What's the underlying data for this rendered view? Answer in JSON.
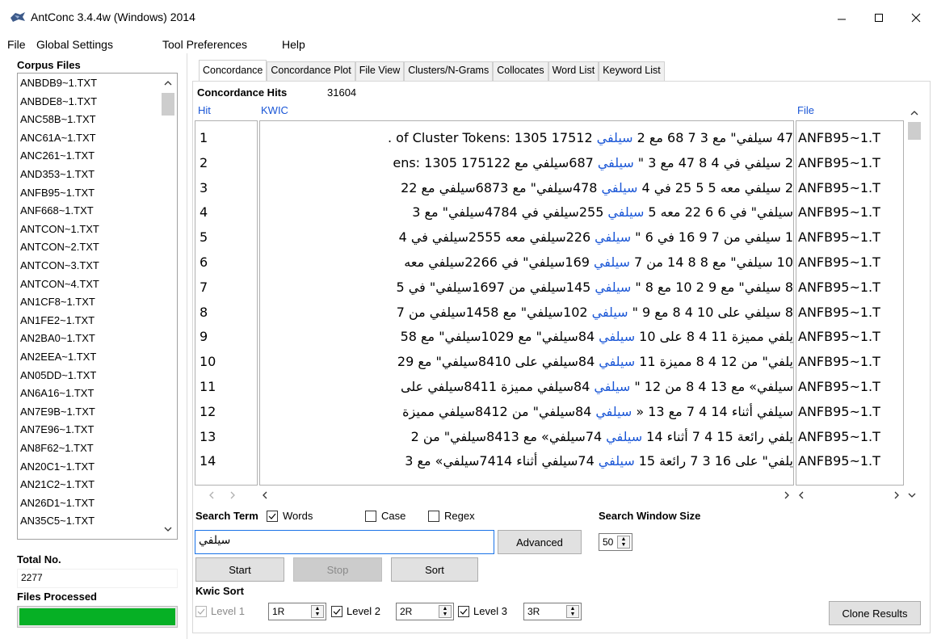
{
  "window": {
    "title": "AntConc 3.4.4w (Windows) 2014",
    "app_icon": "antconc-icon",
    "controls": {
      "minimize": "—",
      "maximize": "☐",
      "close": "✕"
    }
  },
  "menu": [
    "File",
    "Global Settings",
    "Tool Preferences",
    "Help"
  ],
  "corpus": {
    "title": "Corpus Files",
    "files": [
      "ANBDB9~1.TXT",
      "ANBDE8~1.TXT",
      "ANC58B~1.TXT",
      "ANC61A~1.TXT",
      "ANC261~1.TXT",
      "AND353~1.TXT",
      "ANFB95~1.TXT",
      "ANF668~1.TXT",
      "ANTCON~1.TXT",
      "ANTCON~2.TXT",
      "ANTCON~3.TXT",
      "ANTCON~4.TXT",
      "AN1CF8~1.TXT",
      "AN1FE2~1.TXT",
      "AN2BA0~1.TXT",
      "AN2EEA~1.TXT",
      "AN05DD~1.TXT",
      "AN6A16~1.TXT",
      "AN7E9B~1.TXT",
      "AN7E96~1.TXT",
      "AN8F62~1.TXT",
      "AN20C1~1.TXT",
      "AN21C2~1.TXT",
      "AN26D1~1.TXT",
      "AN35C5~1.TXT"
    ],
    "total_label": "Total No.",
    "total_value": "2277",
    "files_processed_label": "Files Processed",
    "progress": 1.0
  },
  "tabs": [
    "Concordance",
    "Concordance Plot",
    "File View",
    "Clusters/N-Grams",
    "Collocates",
    "Word List",
    "Keyword List"
  ],
  "active_tab": "Concordance",
  "concordance": {
    "hits_label": "Concordance Hits",
    "hits_value": "31604",
    "headers": {
      "hit": "Hit",
      "kwic": "KWIC",
      "file": "File"
    },
    "rows": [
      {
        "hit": "1",
        "left": "47 سيلفي\" مع 3 7 68 مع 2 ",
        "keyword": "سيلفي",
        "right": " 17512 1305 :of Cluster Tokens .",
        "file": "ANFB95~1.T"
      },
      {
        "hit": "2",
        "left": "2 سيلفي في 4 8 47 مع 3 \"",
        "keyword": "سيلفي",
        "right": "687سيلفي مع 175122 1305 :ens",
        "file": "ANFB95~1.T"
      },
      {
        "hit": "3",
        "left": "2 سيلفي معه 5 5 25 في 4 ",
        "keyword": "سيلفي",
        "right": "478سيلفي\" مع 6873سيلفي مع 22",
        "file": "ANFB95~1.T"
      },
      {
        "hit": "4",
        "left": "سيلفي\" في 6 6 22 معه 5 ",
        "keyword": "سيلفي",
        "right": "255سيلفي في 4784سيلفي\" مع 3",
        "file": "ANFB95~1.T"
      },
      {
        "hit": "5",
        "left": "1 سيلفي من 7 9 16 في 6 \"",
        "keyword": "سيلفي",
        "right": "226سيلفي معه 2555سيلفي في 4",
        "file": "ANFB95~1.T"
      },
      {
        "hit": "6",
        "left": "10 سيلفي\" مع 8 8 14 من 7 ",
        "keyword": "سيلفي",
        "right": "169سيلفي\" في 2266سيلفي معه",
        "file": "ANFB95~1.T"
      },
      {
        "hit": "7",
        "left": "8 سيلفي\" مع 9 2 10 مع 8 \"",
        "keyword": "سيلفي",
        "right": "145سيلفي من 1697سيلفي\" في 5",
        "file": "ANFB95~1.T"
      },
      {
        "hit": "8",
        "left": "8 سيلفي على 10 4 8 مع 9 \"",
        "keyword": "سيلفي",
        "right": "102سيلفي\" مع 1458سيلفي من 7",
        "file": "ANFB95~1.T"
      },
      {
        "hit": "9",
        "left": "يلفي مميزة 11 4 8 على 10 ",
        "keyword": "سيلفي",
        "right": "84سيلفي\" مع 1029سيلفي\" مع 58",
        "file": "ANFB95~1.T"
      },
      {
        "hit": "10",
        "left": "يلفي\" من 12 4 8 مميزة 11 ",
        "keyword": "سيلفي",
        "right": "84سيلفي على 8410سيلفي\" مع 29",
        "file": "ANFB95~1.T"
      },
      {
        "hit": "11",
        "left": "سيلفي» مع 13 4 8 من 12 \"",
        "keyword": "سيلفي",
        "right": "84سيلفي مميزة 8411سيلفي على",
        "file": "ANFB95~1.T"
      },
      {
        "hit": "12",
        "left": "سيلفي أثناء 14 4 7 مع 13 «",
        "keyword": "سيلفي",
        "right": "84سيلفي\" من 8412سيلفي مميزة",
        "file": "ANFB95~1.T"
      },
      {
        "hit": "13",
        "left": "يلفي رائعة 15 4 7 أثناء 14 ",
        "keyword": "سيلفي",
        "right": "74سيلفي» مع 8413سيلفي\" من 2",
        "file": "ANFB95~1.T"
      },
      {
        "hit": "14",
        "left": "يلفي\" على 16 3 7 رائعة 15 ",
        "keyword": "سيلفي",
        "right": "74سيلفي أثناء 7414سيلفي» مع 3",
        "file": "ANFB95~1.T"
      }
    ]
  },
  "search": {
    "label": "Search Term",
    "words_label": "Words",
    "words_checked": true,
    "case_label": "Case",
    "case_checked": false,
    "regex_label": "Regex",
    "regex_checked": false,
    "term": "سيلفي",
    "advanced_label": "Advanced",
    "window_size_label": "Search Window Size",
    "window_size": "50",
    "start_label": "Start",
    "stop_label": "Stop",
    "sort_label": "Sort"
  },
  "kwic_sort": {
    "label": "Kwic Sort",
    "levels": [
      {
        "label": "Level 1",
        "value": "1R",
        "checked": true,
        "disabled": true
      },
      {
        "label": "Level 2",
        "value": "2R",
        "checked": true,
        "disabled": false
      },
      {
        "label": "Level 3",
        "value": "3R",
        "checked": true,
        "disabled": false
      }
    ]
  },
  "clone_results_label": "Clone Results"
}
